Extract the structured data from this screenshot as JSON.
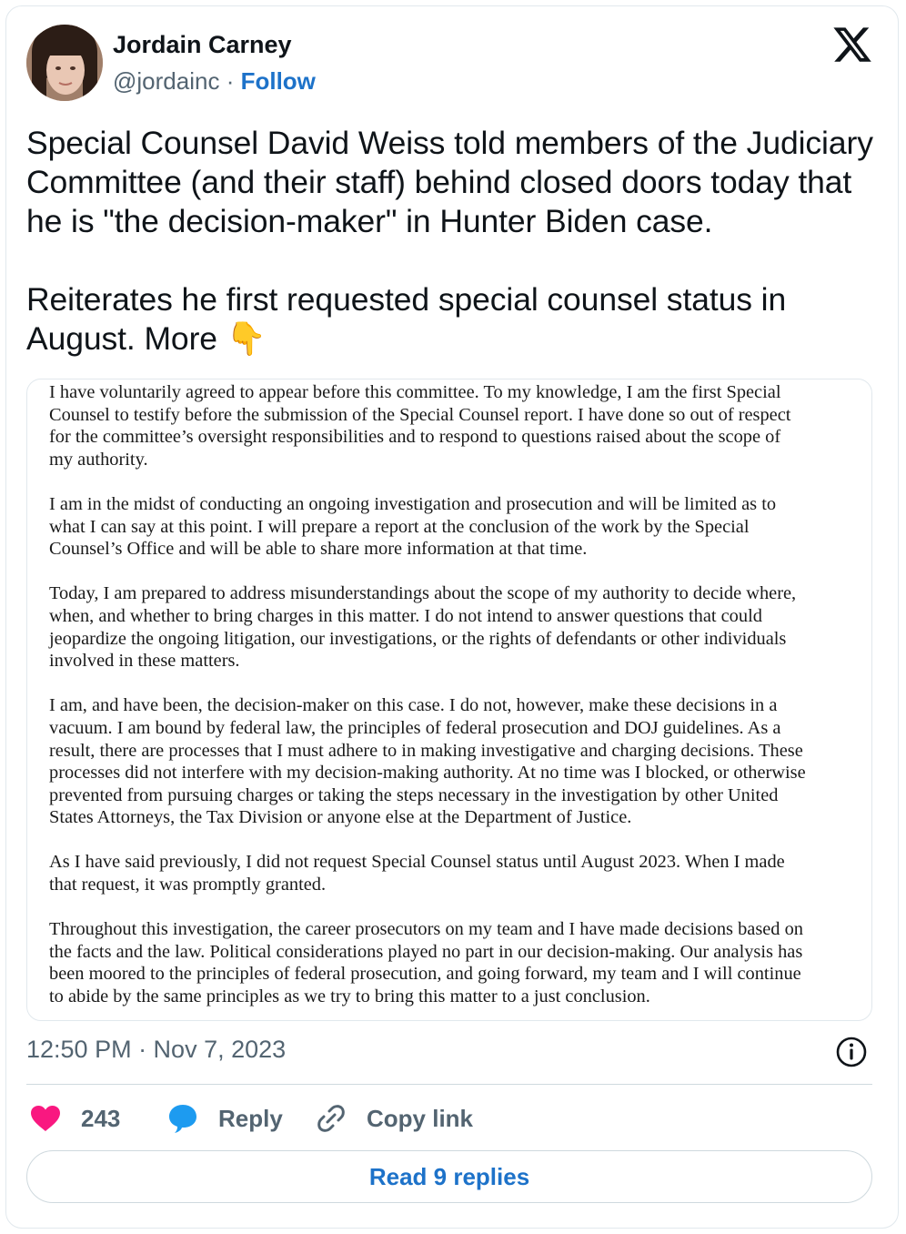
{
  "author": {
    "name": "Jordain Carney",
    "handle": "@jordainc",
    "separator": "·",
    "follow_label": "Follow"
  },
  "tweet": {
    "text": "Special Counsel David Weiss told members of the Judiciary Committee (and their staff) behind closed doors today that he is \"the decision-maker\" in Hunter Biden case.\n\nReiterates he first requested special counsel status in August. More",
    "emoji": "👇"
  },
  "document": {
    "lines": [
      [
        "I have voluntarily agreed to appear before this committee. To my knowledge, I am the first Special",
        "Counsel to testify before the submission of the Special Counsel report. I have done so out of respect",
        "for the committee’s oversight responsibilities and to respond to questions raised about the scope of",
        "my authority."
      ],
      [
        "I am in the midst of conducting an ongoing investigation and prosecution and will be limited as to",
        "what I can say at this point. I will prepare a report at the conclusion of the work by the Special",
        "Counsel’s Office and will be able to share more information at that time."
      ],
      [
        "Today, I am prepared to address misunderstandings about the scope of my authority to decide where,",
        "when, and whether to bring charges in this matter. I do not intend to answer questions that could",
        "jeopardize the ongoing litigation, our investigations, or the rights of defendants or other individuals",
        "involved in these matters."
      ],
      [
        "I am, and have been, the decision-maker on this case. I do not, however, make these decisions in a",
        "vacuum. I am bound by federal law, the principles of federal prosecution and DOJ guidelines. As a",
        "result, there are processes that I must adhere to in making investigative and charging decisions. These",
        "processes did not interfere with my decision-making authority. At no time was I blocked, or otherwise",
        "prevented from pursuing charges or taking the steps necessary in the investigation by other United",
        "States Attorneys, the Tax Division or anyone else at the Department of Justice."
      ],
      [
        "As I have said previously, I did not request Special Counsel status until August 2023. When I made",
        "that request, it was promptly granted."
      ],
      [
        "Throughout this investigation, the career prosecutors on my team and I have made decisions based on",
        "the facts and the law. Political considerations played no part in our decision-making. Our analysis has",
        "been moored to the principles of federal prosecution, and going forward, my team and I will continue",
        "to abide by the same principles as we try to bring this matter to a just conclusion."
      ]
    ]
  },
  "meta": {
    "timestamp": "12:50 PM · Nov 7, 2023"
  },
  "actions": {
    "like_count": "243",
    "reply_label": "Reply",
    "copy_link_label": "Copy link"
  },
  "read_replies_label": "Read 9 replies",
  "colors": {
    "link": "#1d72c9",
    "heart": "#f91880",
    "reply_bubble": "#1d9bf0",
    "muted": "#536471"
  },
  "icons": [
    "x-logo-icon",
    "info-icon",
    "heart-icon",
    "reply-bubble-icon",
    "link-icon",
    "point-down-emoji"
  ]
}
